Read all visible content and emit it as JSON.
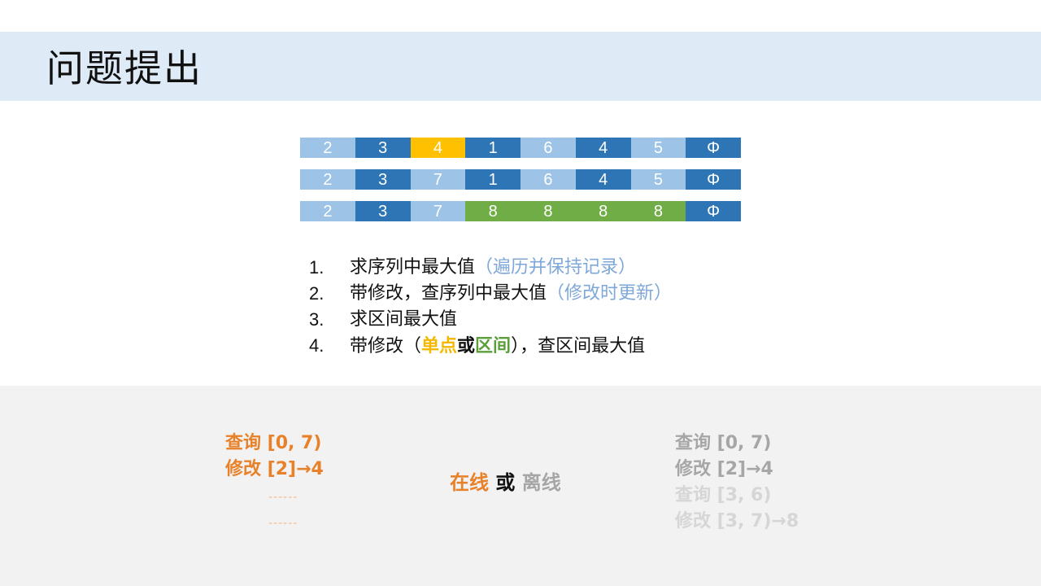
{
  "page": {
    "title": "问题提出"
  },
  "colors": {
    "light_blue": "#9dc3e6",
    "dark_blue": "#2e75b6",
    "yellow": "#ffc000",
    "green": "#70ad47",
    "orange": "#e8822a",
    "gray": "#a6a6a6",
    "light_gray": "#d6d6d6"
  },
  "arrays": [
    {
      "cells": [
        {
          "v": "2",
          "c": "light_blue"
        },
        {
          "v": "3",
          "c": "dark_blue"
        },
        {
          "v": "4",
          "c": "yellow"
        },
        {
          "v": "1",
          "c": "dark_blue"
        },
        {
          "v": "6",
          "c": "light_blue"
        },
        {
          "v": "4",
          "c": "dark_blue"
        },
        {
          "v": "5",
          "c": "light_blue"
        },
        {
          "v": "Φ",
          "c": "dark_blue"
        }
      ]
    },
    {
      "cells": [
        {
          "v": "2",
          "c": "light_blue"
        },
        {
          "v": "3",
          "c": "dark_blue"
        },
        {
          "v": "7",
          "c": "light_blue"
        },
        {
          "v": "1",
          "c": "dark_blue"
        },
        {
          "v": "6",
          "c": "light_blue"
        },
        {
          "v": "4",
          "c": "dark_blue"
        },
        {
          "v": "5",
          "c": "light_blue"
        },
        {
          "v": "Φ",
          "c": "dark_blue"
        }
      ]
    },
    {
      "cells": [
        {
          "v": "2",
          "c": "light_blue"
        },
        {
          "v": "3",
          "c": "dark_blue"
        },
        {
          "v": "7",
          "c": "light_blue"
        },
        {
          "v": "8",
          "c": "green"
        },
        {
          "v": "8",
          "c": "green"
        },
        {
          "v": "8",
          "c": "green"
        },
        {
          "v": "8",
          "c": "green"
        },
        {
          "v": "Φ",
          "c": "dark_blue"
        }
      ]
    }
  ],
  "list": {
    "item1": {
      "num": "1.",
      "text": "求序列中最大值",
      "hint": "（遍历并保持记录）"
    },
    "item2": {
      "num": "2.",
      "text": "带修改，查序列中最大值",
      "hint": "（修改时更新）"
    },
    "item3": {
      "num": "3.",
      "text": "求区间最大值"
    },
    "item4": {
      "num": "4.",
      "prefix": "带修改（",
      "single": "单点",
      "or": "或",
      "range": "区间",
      "suffix": "），查区间最大值"
    }
  },
  "online_ops": {
    "lines": [
      "查询 [0, 7)",
      "修改 [2]→4"
    ],
    "dots": [
      "------",
      "------"
    ]
  },
  "mode": {
    "online": "在线",
    "or": "或",
    "offline": "离线"
  },
  "offline_ops": {
    "lines": [
      {
        "text": "查询 [0, 7)",
        "c": "gray"
      },
      {
        "text": "修改 [2]→4",
        "c": "gray"
      },
      {
        "text": "查询 [3, 6)",
        "c": "light_gray"
      },
      {
        "text": "修改 [3, 7)→8",
        "c": "light_gray"
      }
    ]
  }
}
